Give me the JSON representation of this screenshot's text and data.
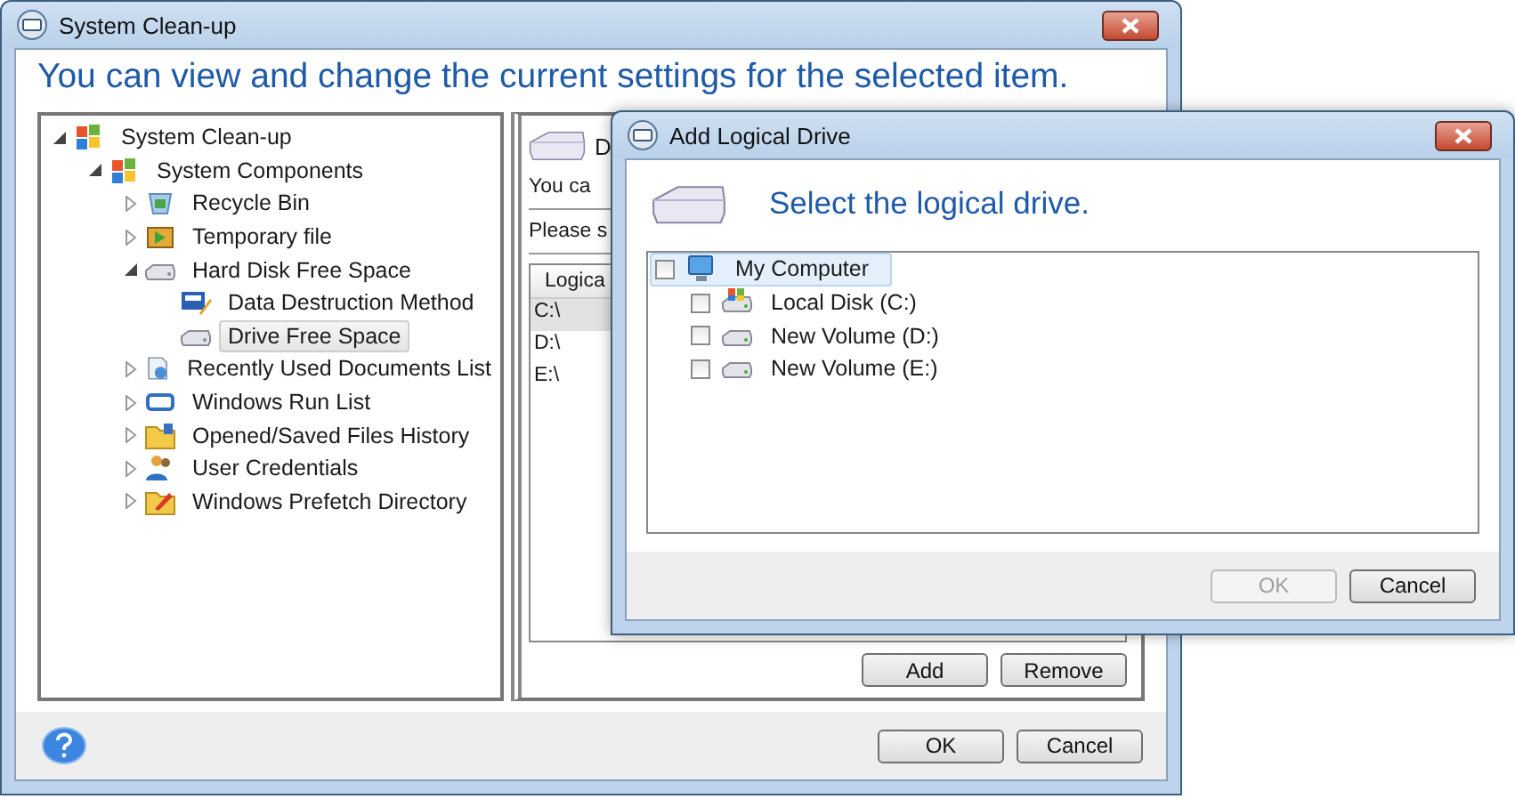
{
  "main_window": {
    "title": "System Clean-up",
    "heading": "You can view and change the current settings for the selected item.",
    "tree": [
      {
        "label": "System Clean-up",
        "kind": "flag",
        "expanded": true,
        "selected": false,
        "children": [
          {
            "label": "System Components",
            "kind": "flag",
            "expanded": true,
            "selected": false,
            "children": [
              {
                "label": "Recycle Bin",
                "kind": "recycle-bin",
                "expanded": false,
                "selected": false
              },
              {
                "label": "Temporary file",
                "kind": "temp-file",
                "expanded": false,
                "selected": false
              },
              {
                "label": "Hard Disk Free Space",
                "kind": "disk",
                "expanded": true,
                "selected": false,
                "children": [
                  {
                    "label": "Data Destruction Method",
                    "kind": "numbers",
                    "selected": false
                  },
                  {
                    "label": "Drive Free Space",
                    "kind": "disk",
                    "selected": true
                  }
                ]
              },
              {
                "label": "Recently Used Documents List",
                "kind": "document",
                "expanded": false,
                "selected": false
              },
              {
                "label": "Windows Run List",
                "kind": "window",
                "expanded": false,
                "selected": false
              },
              {
                "label": "Opened/Saved Files History",
                "kind": "folder",
                "expanded": false,
                "selected": false
              },
              {
                "label": "User Credentials",
                "kind": "users",
                "expanded": false,
                "selected": false
              },
              {
                "label": "Windows Prefetch Directory",
                "kind": "prefetch",
                "expanded": false,
                "selected": false
              }
            ]
          }
        ]
      }
    ],
    "detail": {
      "title": "D",
      "description": "You ca",
      "prompt": "Please s",
      "drives": {
        "columns": [
          "Logica"
        ],
        "rows": [
          {
            "cells": [
              "C:\\"
            ],
            "selected": true
          },
          {
            "cells": [
              "D:\\"
            ],
            "selected": false
          },
          {
            "cells": [
              "E:\\"
            ],
            "selected": false
          }
        ]
      },
      "buttons": [
        {
          "label": "Add",
          "disabled": false
        },
        {
          "label": "Remove",
          "disabled": false
        }
      ]
    },
    "buttons": [
      {
        "label": "OK",
        "disabled": false
      },
      {
        "label": "Cancel",
        "disabled": false
      }
    ]
  },
  "dialog": {
    "title": "Add Logical Drive",
    "heading": "Select the logical drive.",
    "tree": [
      {
        "label": "My Computer",
        "kind": "computer",
        "checked": false,
        "selected": true,
        "children": [
          {
            "label": "Local Disk (C:)",
            "kind": "system-disk",
            "checked": false,
            "selected": false
          },
          {
            "label": "New Volume (D:)",
            "kind": "volume",
            "checked": false,
            "selected": false
          },
          {
            "label": "New Volume (E:)",
            "kind": "volume",
            "checked": false,
            "selected": false
          }
        ]
      }
    ],
    "buttons": [
      {
        "label": "OK",
        "disabled": true
      },
      {
        "label": "Cancel",
        "disabled": false
      }
    ]
  }
}
